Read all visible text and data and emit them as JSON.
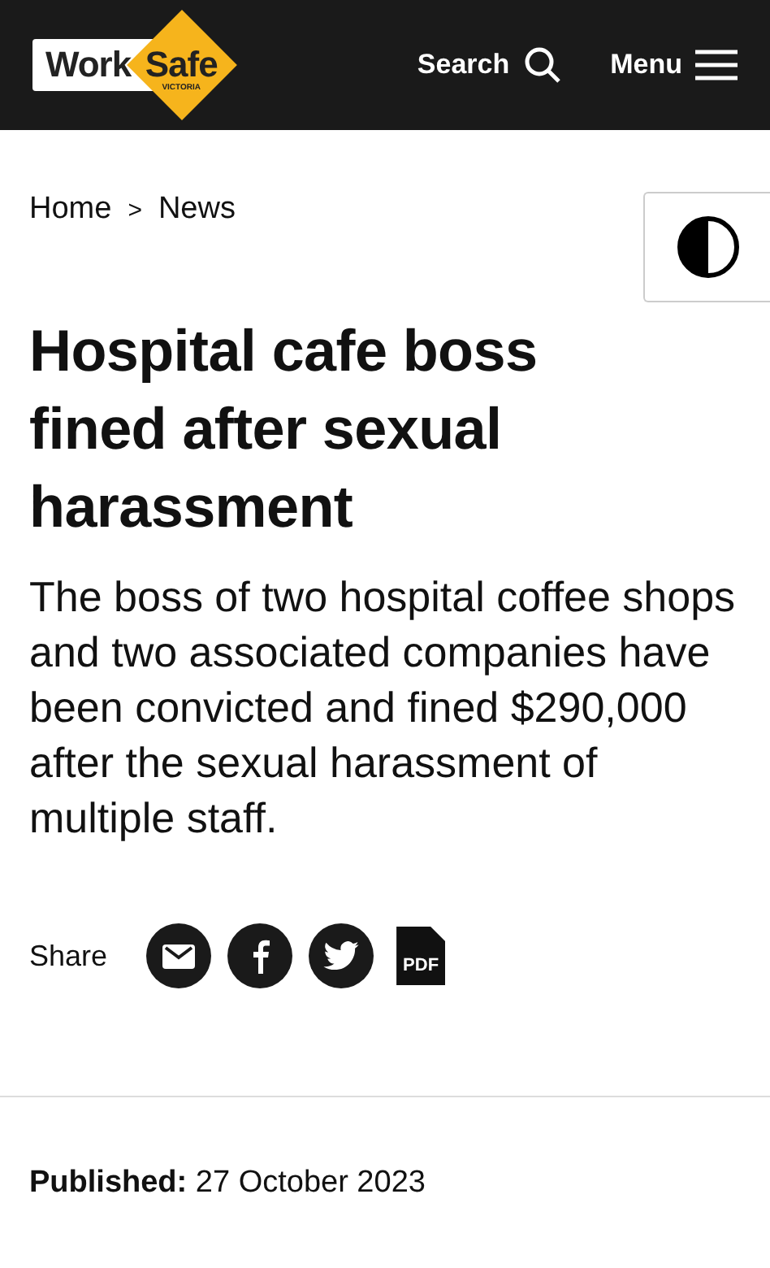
{
  "header": {
    "logo": {
      "left": "Work",
      "right": "Safe",
      "sub": "VICTORIA"
    },
    "search": "Search",
    "menu": "Menu"
  },
  "breadcrumb": [
    "Home",
    "News"
  ],
  "breadcrumb_separator": ">",
  "title": "Hospital cafe boss fined after sexual harassment",
  "summary": "The boss of two hospital coffee shops and two associated companies have been convicted and fined $290,000 after the sexual harassment of multiple staff.",
  "share": {
    "label": "Share",
    "buttons": [
      {
        "kind": "email"
      },
      {
        "kind": "facebook"
      },
      {
        "kind": "twitter"
      },
      {
        "kind": "pdf",
        "text": "PDF"
      }
    ]
  },
  "published": {
    "label": "Published:",
    "date": "27 October 2023"
  }
}
